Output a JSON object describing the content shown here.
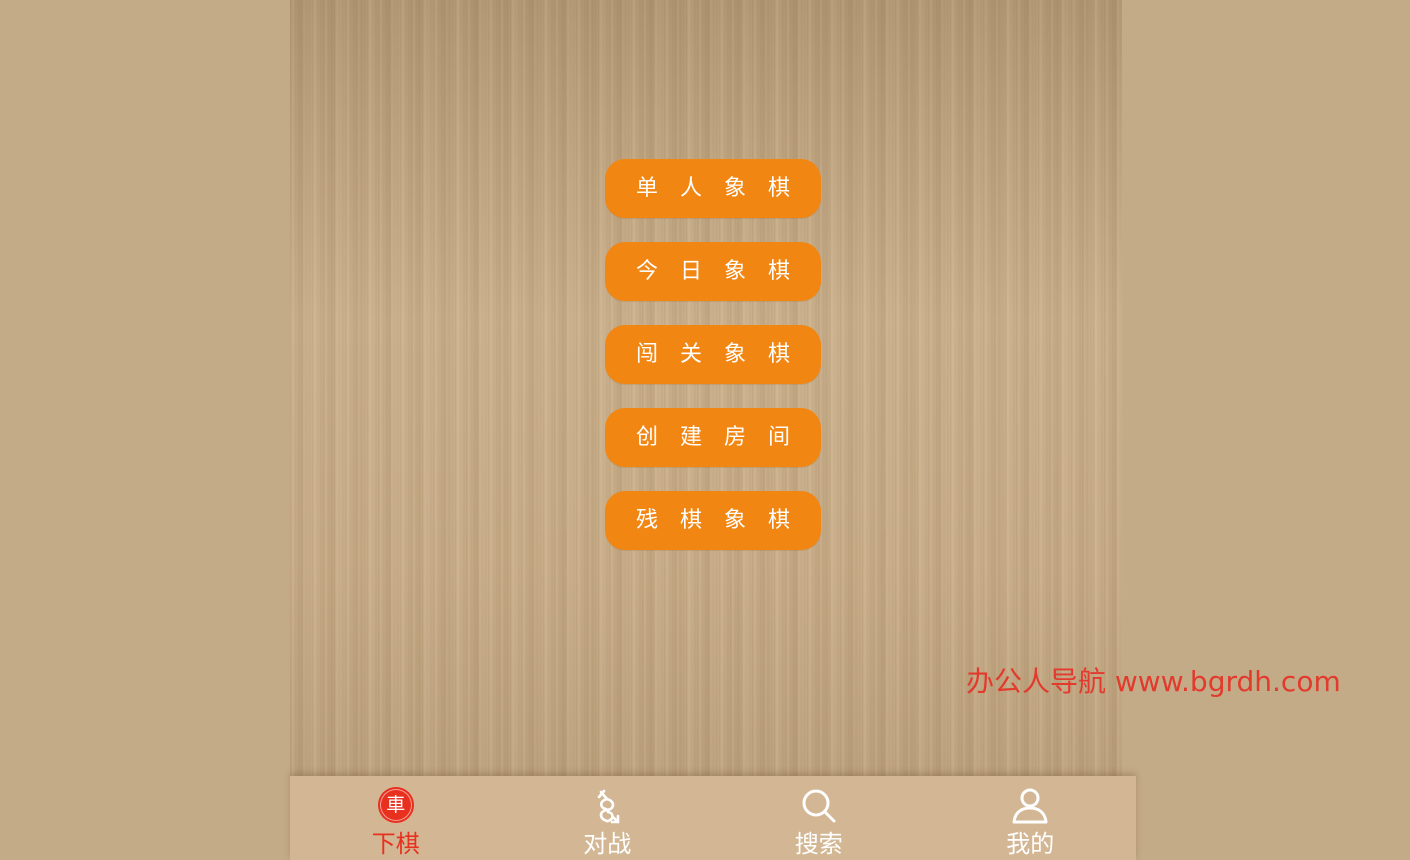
{
  "menu": {
    "items": [
      {
        "label": "单人象棋"
      },
      {
        "label": "今日象棋"
      },
      {
        "label": "闯关象棋"
      },
      {
        "label": "创建房间"
      },
      {
        "label": "残棋象棋"
      }
    ]
  },
  "watermark": {
    "text": "办公人导航 www.bgrdh.com"
  },
  "tabbar": {
    "active_color": "#e8301f",
    "inactive_color": "#ffffff",
    "tabs": [
      {
        "label": "下棋",
        "icon": "chariot-piece-icon",
        "icon_text": "車",
        "active": true
      },
      {
        "label": "对战",
        "icon": "battle-swords-icon",
        "active": false
      },
      {
        "label": "搜索",
        "icon": "search-icon",
        "active": false
      },
      {
        "label": "我的",
        "icon": "user-icon",
        "active": false
      }
    ]
  },
  "colors": {
    "button": "#f28613",
    "background": "#c4ab87",
    "tabbar": "#d3b794"
  }
}
